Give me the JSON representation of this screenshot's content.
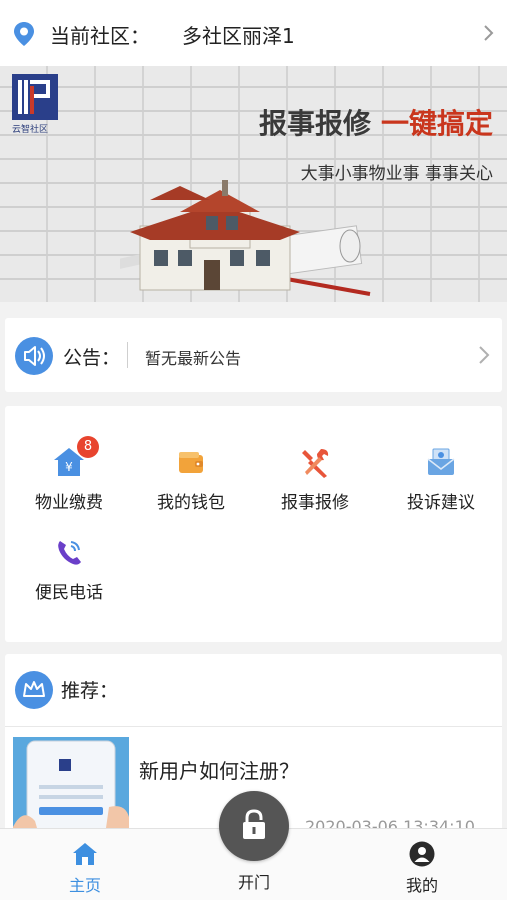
{
  "community": {
    "label": "当前社区：",
    "value": "多社区丽泽1"
  },
  "banner": {
    "logo_text": "云智社区",
    "headline_main": "报事报修",
    "headline_accent": "一键搞定",
    "subline": "大事小事物业事   事事关心"
  },
  "notice": {
    "label": "公告：",
    "text": "暂无最新公告"
  },
  "services": [
    {
      "label": "物业缴费",
      "icon": "house-yen-icon",
      "badge": "8"
    },
    {
      "label": "我的钱包",
      "icon": "wallet-icon"
    },
    {
      "label": "报事报修",
      "icon": "tools-icon"
    },
    {
      "label": "投诉建议",
      "icon": "mail-icon"
    },
    {
      "label": "便民电话",
      "icon": "phone-icon"
    }
  ],
  "recommend": {
    "label": "推荐：",
    "articles": [
      {
        "title": "新用户如何注册？",
        "date": "2020-03-06 13:34:10"
      }
    ]
  },
  "tabbar": {
    "home": "主页",
    "open": "开门",
    "mine": "我的"
  },
  "colors": {
    "accent": "#3d8fe0",
    "banner_accent": "#c9361d",
    "badge": "#e8442e",
    "open_button": "#555555"
  }
}
